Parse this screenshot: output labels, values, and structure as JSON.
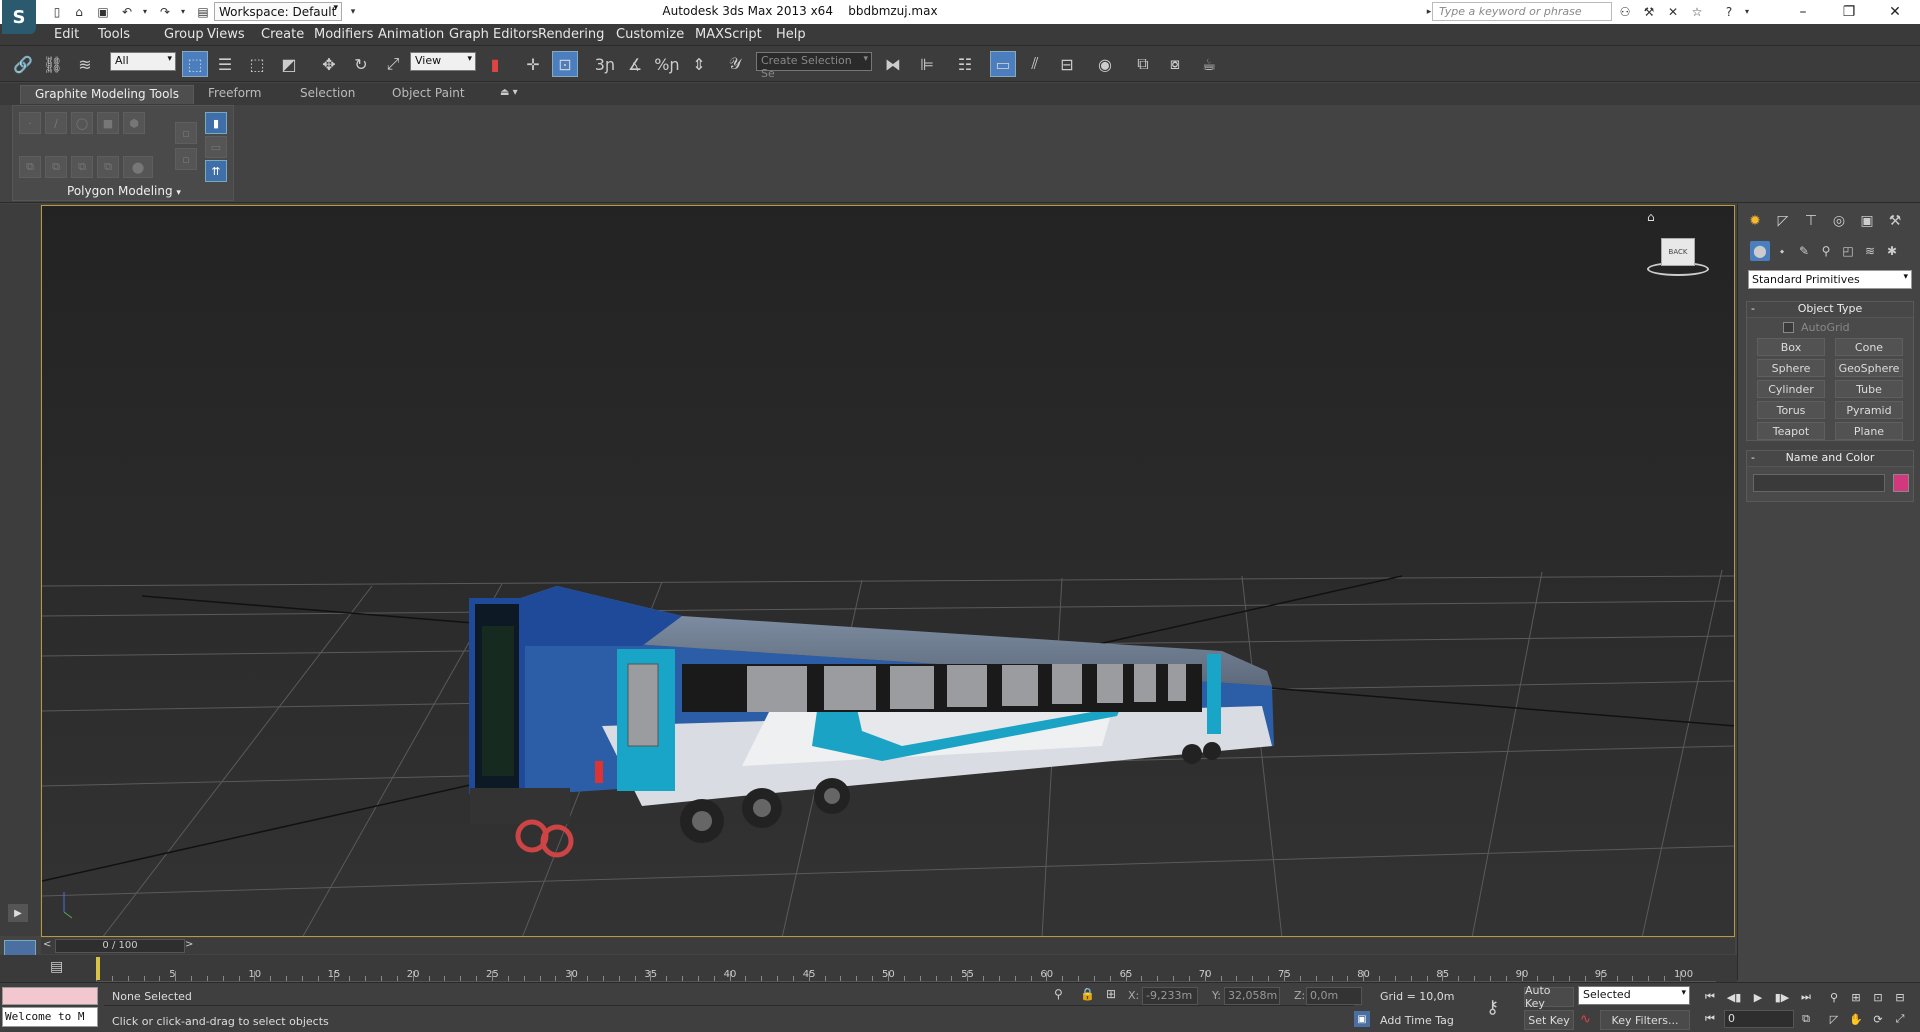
{
  "titlebar": {
    "app_title": "Autodesk 3ds Max  2013 x64",
    "file_name": "bbdbmzuj.max",
    "workspace": "Workspace: Default",
    "search_placeholder": "Type a keyword or phrase"
  },
  "menu": [
    "Edit",
    "Tools",
    "Group",
    "Views",
    "Create",
    "Modifiers",
    "Animation",
    "Graph Editors",
    "Rendering",
    "Customize",
    "MAXScript",
    "Help"
  ],
  "toolbar": {
    "filter_value": "All",
    "refcoord_value": "View",
    "numbers": [
      "3",
      "%"
    ],
    "selection_set_placeholder": "Create Selection Se"
  },
  "ribbon": {
    "tabs": [
      "Graphite Modeling Tools",
      "Freeform",
      "Selection",
      "Object Paint"
    ],
    "panel_label": "Polygon Modeling"
  },
  "viewcube_label": "BACK",
  "command_panel": {
    "dropdown": "Standard Primitives",
    "object_type_title": "Object Type",
    "autogrid_label": "AutoGrid",
    "buttons": [
      "Box",
      "Cone",
      "Sphere",
      "GeoSphere",
      "Cylinder",
      "Tube",
      "Torus",
      "Pyramid",
      "Teapot",
      "Plane"
    ],
    "name_color_title": "Name and Color",
    "color": "#d2397c"
  },
  "timeline": {
    "frame_display": "0 / 100",
    "ticks": [
      "5",
      "10",
      "15",
      "20",
      "25",
      "30",
      "35",
      "40",
      "45",
      "50",
      "55",
      "60",
      "65",
      "70",
      "75",
      "80",
      "85",
      "90",
      "95",
      "100"
    ]
  },
  "status": {
    "maxscript_listener": "Welcome to M",
    "selection_status": "None Selected",
    "prompt": "Click or click-and-drag to select objects",
    "x_label": "X:",
    "x_value": "-9,233m",
    "y_label": "Y:",
    "y_value": "32,058m",
    "z_label": "Z:",
    "z_value": "0,0m",
    "grid": "Grid = 10,0m",
    "add_time_tag": "Add Time Tag",
    "auto_key": "Auto Key",
    "set_key": "Set Key",
    "key_mode": "Selected",
    "key_filters": "Key Filters...",
    "current_frame": "0"
  }
}
